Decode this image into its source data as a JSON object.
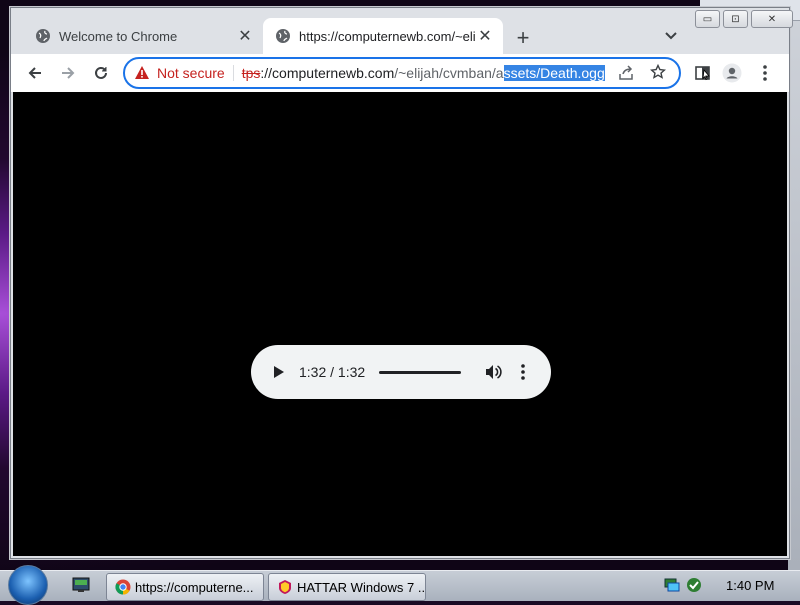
{
  "browser": {
    "tabs": [
      {
        "label": "Welcome to Chrome",
        "icon": "globe-icon",
        "active": false
      },
      {
        "label": "https://computernewb.com/~elij",
        "icon": "globe-icon",
        "active": true
      }
    ],
    "window_controls": {
      "minimize": "▭",
      "maximize": "⊡",
      "close": "✕"
    },
    "omnibox": {
      "security_label": "Not secure",
      "url_scheme": "tps",
      "url_host_prefix": "://computernewb.com",
      "url_path_visible": "/~elijah/cvmban/a",
      "url_selected": "ssets/Death.ogg"
    }
  },
  "player": {
    "time_display": "1:32 / 1:32",
    "progress": 1.0
  },
  "taskbar": {
    "buttons": [
      {
        "label": "https://computerne...",
        "icon": "chrome-icon"
      },
      {
        "label": "HATTAR Windows 7 ...",
        "icon": "app-icon"
      }
    ],
    "clock": "1:40 PM"
  },
  "colors": {
    "accent": "#1a73e8",
    "warning": "#c5221f",
    "selection": "#3584e4"
  }
}
